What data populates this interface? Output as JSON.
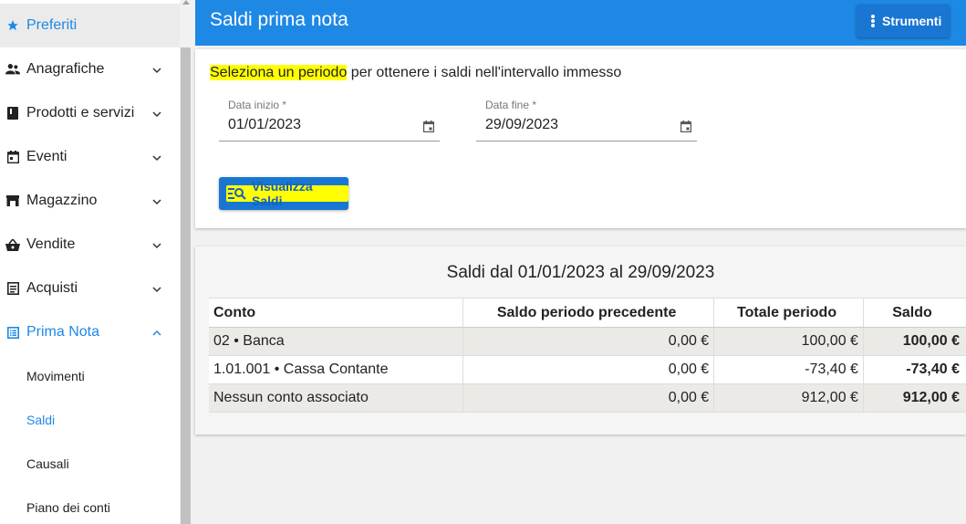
{
  "sidebar": {
    "favorites": "Preferiti",
    "items": [
      {
        "label": "Anagrafiche",
        "icon": "people-icon"
      },
      {
        "label": "Prodotti e servizi",
        "icon": "book-icon"
      },
      {
        "label": "Eventi",
        "icon": "calendar-icon"
      },
      {
        "label": "Magazzino",
        "icon": "warehouse-icon"
      },
      {
        "label": "Vendite",
        "icon": "basket-icon"
      },
      {
        "label": "Acquisti",
        "icon": "receipt-icon"
      },
      {
        "label": "Prima Nota",
        "icon": "list-icon"
      }
    ],
    "subitems": [
      "Movimenti",
      "Saldi",
      "Causali",
      "Piano dei conti"
    ],
    "active_subitem": "Saldi"
  },
  "header": {
    "title": "Saldi prima nota",
    "tools_label": "Strumenti"
  },
  "filters": {
    "intro_highlight": "Seleziona un periodo",
    "intro_rest": " per ottenere i saldi nell'intervallo immesso",
    "start_label": "Data inizio *",
    "start_value": "01/01/2023",
    "end_label": "Data fine *",
    "end_value": "29/09/2023",
    "button_label": "Visualizza Saldi"
  },
  "results": {
    "heading": "Saldi dal 01/01/2023 al 29/09/2023",
    "columns": [
      "Conto",
      "Saldo periodo precedente",
      "Totale periodo",
      "Saldo"
    ],
    "rows": [
      {
        "conto": "02 • Banca",
        "prec": "0,00 €",
        "tot": "100,00 €",
        "saldo": "100,00 €"
      },
      {
        "conto": "1.01.001 • Cassa Contante",
        "prec": "0,00 €",
        "tot": "-73,40 €",
        "saldo": "-73,40 €"
      },
      {
        "conto": "Nessun conto associato",
        "prec": "0,00 €",
        "tot": "912,00 €",
        "saldo": "912,00 €"
      }
    ]
  },
  "colors": {
    "primary": "#1e88e5",
    "button": "#1976d2",
    "highlight": "#ffff00"
  }
}
